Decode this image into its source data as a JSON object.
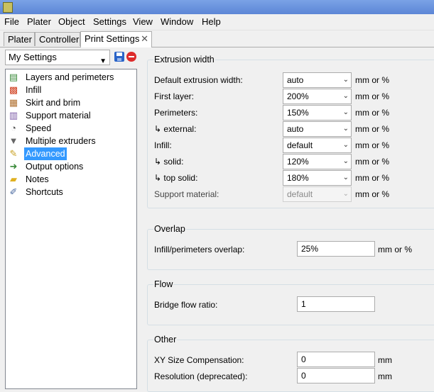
{
  "menu": [
    "File",
    "Plater",
    "Object",
    "Settings",
    "View",
    "Window",
    "Help"
  ],
  "tabs": {
    "plater": "Plater",
    "controller": "Controller",
    "print_settings": "Print Settings",
    "close": "✕"
  },
  "preset": {
    "selected": "My Settings"
  },
  "pages": [
    {
      "label": "Layers and perimeters",
      "icon": "layers-icon"
    },
    {
      "label": "Infill",
      "icon": "infill-icon"
    },
    {
      "label": "Skirt and brim",
      "icon": "skirt-icon"
    },
    {
      "label": "Support material",
      "icon": "support-icon"
    },
    {
      "label": "Speed",
      "icon": "speed-icon"
    },
    {
      "label": "Multiple extruders",
      "icon": "funnel-icon"
    },
    {
      "label": "Advanced",
      "icon": "wrench-icon",
      "selected": true
    },
    {
      "label": "Output options",
      "icon": "output-icon"
    },
    {
      "label": "Notes",
      "icon": "note-icon"
    },
    {
      "label": "Shortcuts",
      "icon": "shortcut-icon"
    }
  ],
  "extrusion": {
    "title": "Extrusion width",
    "unit": "mm or %",
    "rows": [
      {
        "label": "Default extrusion width:",
        "value": "auto"
      },
      {
        "label": "First layer:",
        "value": "200%"
      },
      {
        "label": "Perimeters:",
        "value": "150%"
      },
      {
        "label": "↳ external:",
        "value": "auto"
      },
      {
        "label": "Infill:",
        "value": "default"
      },
      {
        "label": "↳ solid:",
        "value": "120%"
      },
      {
        "label": "↳ top solid:",
        "value": "180%"
      },
      {
        "label": "Support material:",
        "value": "default",
        "disabled": true
      }
    ]
  },
  "overlap": {
    "title": "Overlap",
    "label": "Infill/perimeters overlap:",
    "value": "25%",
    "unit": "mm or %"
  },
  "flow": {
    "title": "Flow",
    "label": "Bridge flow ratio:",
    "value": "1"
  },
  "other": {
    "title": "Other",
    "xy_label": "XY Size Compensation:",
    "xy_value": "0",
    "xy_unit": "mm",
    "res_label": "Resolution (deprecated):",
    "res_value": "0",
    "res_unit": "mm"
  },
  "colors": {
    "selection": "#3399ff",
    "titlebar": "#6b93dd"
  }
}
